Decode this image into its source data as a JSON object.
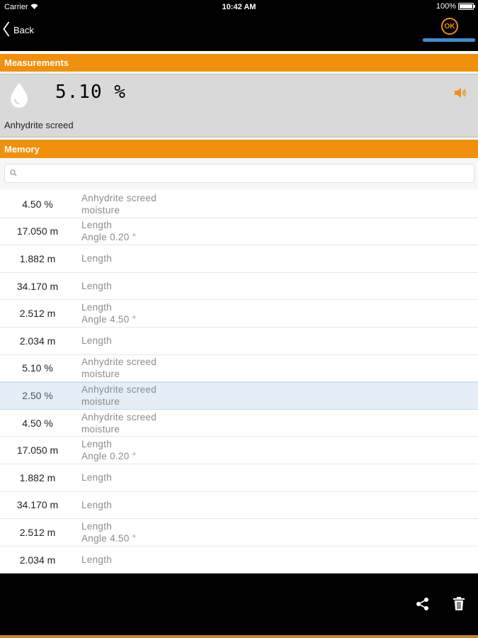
{
  "status_bar": {
    "carrier": "Carrier",
    "time": "10:42 AM",
    "battery": "100%"
  },
  "nav": {
    "back_label": "Back",
    "ok_label": "OK"
  },
  "measurements": {
    "header": "Measurements",
    "value": "5.10 %",
    "material": "Anhydrite screed"
  },
  "memory": {
    "header": "Memory",
    "search_placeholder": "",
    "rows": [
      {
        "value": "4.50 %",
        "line1": "Anhydrite screed",
        "line2": "moisture"
      },
      {
        "value": "17.050 m",
        "line1": "Length",
        "line2": "Angle  0.20 °"
      },
      {
        "value": "1.882 m",
        "line1": "Length",
        "line2": ""
      },
      {
        "value": "34.170 m",
        "line1": "Length",
        "line2": ""
      },
      {
        "value": "2.512 m",
        "line1": "Length",
        "line2": "Angle  4.50 °"
      },
      {
        "value": "2.034 m",
        "line1": "Length",
        "line2": ""
      },
      {
        "value": "5.10 %",
        "line1": "Anhydrite screed",
        "line2": "moisture"
      },
      {
        "value": "2.50 %",
        "line1": "Anhydrite screed",
        "line2": "moisture",
        "selected": true
      },
      {
        "value": "4.50 %",
        "line1": "Anhydrite screed",
        "line2": "moisture"
      },
      {
        "value": "17.050 m",
        "line1": "Length",
        "line2": "Angle  0.20 °"
      },
      {
        "value": "1.882 m",
        "line1": "Length",
        "line2": ""
      },
      {
        "value": "34.170 m",
        "line1": "Length",
        "line2": ""
      },
      {
        "value": "2.512 m",
        "line1": "Length",
        "line2": "Angle  4.50 °"
      },
      {
        "value": "2.034 m",
        "line1": "Length",
        "line2": ""
      }
    ]
  },
  "icons": {
    "back": "chevron-left-icon",
    "ok": "ok-circle-icon",
    "drop": "water-drop-icon",
    "speaker": "speaker-icon",
    "search": "search-icon",
    "share": "share-icon",
    "trash": "trash-icon"
  },
  "colors": {
    "accent": "#f0900c",
    "selection": "#e5eef6",
    "bar": "#3e8bcc"
  }
}
